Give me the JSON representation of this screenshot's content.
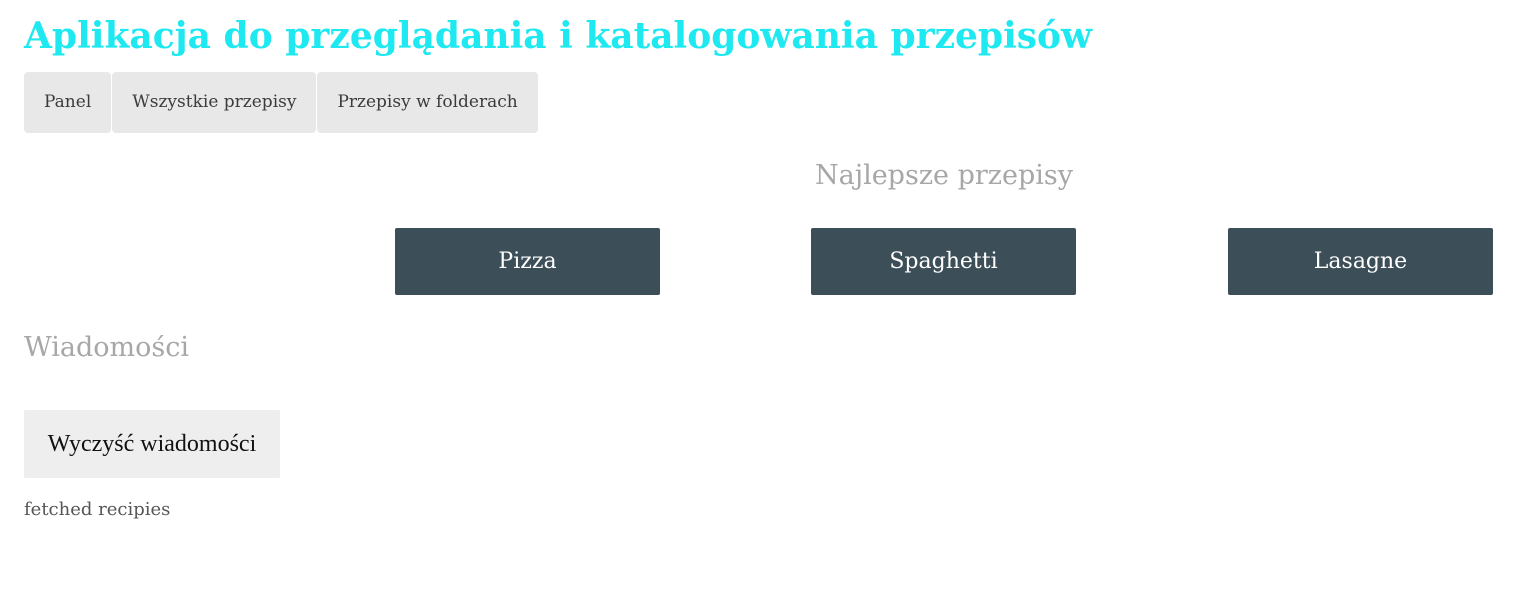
{
  "header": {
    "title": "Aplikacja do przeglądania i katalogowania przepisów"
  },
  "nav": {
    "items": [
      {
        "label": "Panel"
      },
      {
        "label": "Wszystkie przepisy"
      },
      {
        "label": "Przepisy w folderach"
      }
    ]
  },
  "top_recipes": {
    "title": "Najlepsze przepisy",
    "items": [
      {
        "label": "Pizza"
      },
      {
        "label": "Spaghetti"
      },
      {
        "label": "Lasagne"
      }
    ]
  },
  "messages": {
    "title": "Wiadomości",
    "clear_label": "Wyczyść wiadomości",
    "items": [
      "fetched recipies"
    ]
  },
  "colors": {
    "title": "#1ee8f0",
    "card_bg": "#3c4e58",
    "nav_bg": "#e8e8e8",
    "section_title": "#a7a7a7"
  }
}
